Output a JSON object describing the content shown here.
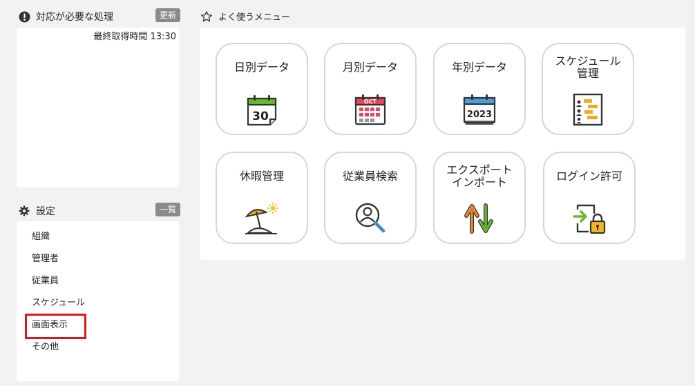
{
  "alerts": {
    "title": "対応が必要な処理",
    "refresh_label": "更新",
    "timestamp": "最終取得時間 13:30"
  },
  "settings": {
    "title": "設定",
    "list_label": "一覧",
    "items": [
      {
        "label": "組織"
      },
      {
        "label": "管理者"
      },
      {
        "label": "従業員"
      },
      {
        "label": "スケジュール"
      },
      {
        "label": "画面表示"
      },
      {
        "label": "その他"
      }
    ]
  },
  "favorites": {
    "title": "よく使うメニュー",
    "items": [
      {
        "label": "日別データ",
        "icon": "daily-calendar-icon",
        "day": "30"
      },
      {
        "label": "月別データ",
        "icon": "monthly-calendar-icon",
        "month": "OCT"
      },
      {
        "label": "年別データ",
        "icon": "yearly-calendar-icon",
        "year": "2023"
      },
      {
        "label": "スケジュール\n管理",
        "icon": "schedule-chart-icon"
      },
      {
        "label": "休暇管理",
        "icon": "beach-umbrella-icon"
      },
      {
        "label": "従業員検索",
        "icon": "employee-search-icon"
      },
      {
        "label": "エクスポート\nインポート",
        "icon": "export-import-arrows-icon"
      },
      {
        "label": "ログイン許可",
        "icon": "login-lock-icon"
      }
    ]
  },
  "colors": {
    "highlight": "#e0141b",
    "daily_green": "#66bb2c",
    "monthly_red": "#e8445a",
    "yearly_blue": "#4a9fe0",
    "schedule_orange": "#f5a623"
  }
}
